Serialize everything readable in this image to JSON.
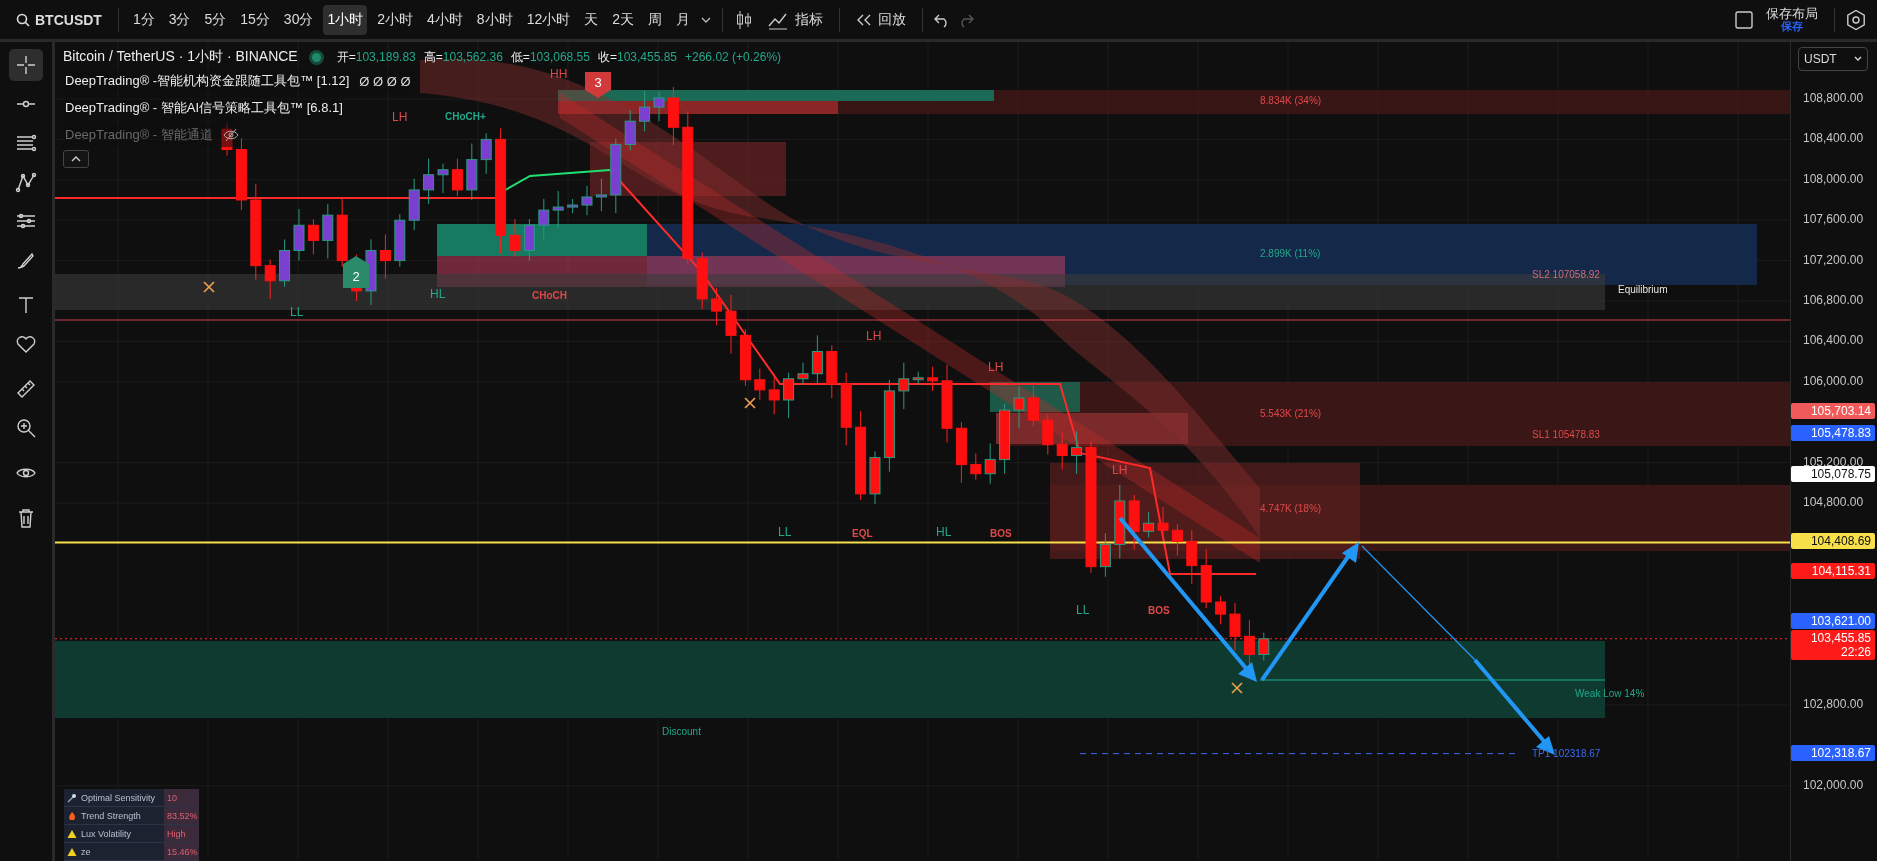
{
  "toolbar": {
    "symbol": "BTCUSDT",
    "intervals": [
      {
        "label": "1分",
        "selected": false
      },
      {
        "label": "3分",
        "selected": false
      },
      {
        "label": "5分",
        "selected": false
      },
      {
        "label": "15分",
        "selected": false
      },
      {
        "label": "30分",
        "selected": false
      },
      {
        "label": "1小时",
        "selected": true
      },
      {
        "label": "2小时",
        "selected": false
      },
      {
        "label": "4小时",
        "selected": false
      },
      {
        "label": "8小时",
        "selected": false
      },
      {
        "label": "12小时",
        "selected": false
      },
      {
        "label": "天",
        "selected": false
      },
      {
        "label": "2天",
        "selected": false
      },
      {
        "label": "周",
        "selected": false
      },
      {
        "label": "月",
        "selected": false
      }
    ],
    "indicators_button": "指标",
    "replay_button": "回放",
    "save_layout": {
      "title": "保存布局",
      "subtitle": "保存"
    }
  },
  "tools": [
    {
      "selected": true
    },
    {
      "selected": false
    },
    {
      "selected": false
    },
    {
      "selected": false
    },
    {
      "selected": false
    },
    {
      "selected": false
    },
    {
      "selected": false
    },
    {
      "selected": false
    },
    {
      "selected": false
    },
    {
      "selected": false
    },
    {
      "selected": false
    },
    {
      "selected": false
    }
  ],
  "legend": {
    "title": "Bitcoin / TetherUS · 1小时 · BINANCE",
    "ohlc": [
      {
        "label": "开=",
        "value": "103,189.83"
      },
      {
        "label": "高=",
        "value": "103,562.36"
      },
      {
        "label": "低=",
        "value": "103,068.55"
      },
      {
        "label": "收=",
        "value": "103,455.85"
      }
    ],
    "change": "+266.02 (+0.26%)",
    "indicators": [
      {
        "name": "DeepTrading® -智能机构资金跟随工具包™ [1.12]",
        "values": "Ø Ø Ø Ø",
        "visible": true
      },
      {
        "name": "DeepTrading® - 智能AI信号策略工具包™ [6.8.1]",
        "visible": true
      },
      {
        "name": "DeepTrading® - 智能通道",
        "visible": false
      }
    ]
  },
  "currency": "USDT",
  "price_axis": {
    "ticks": [
      "108,800.00",
      "108,400.00",
      "108,000.00",
      "107,600.00",
      "107,200.00",
      "106,800.00",
      "106,400.00",
      "106,000.00",
      "105,200.00",
      "104,800.00",
      "102,800.00",
      "102,000.00"
    ],
    "tags": [
      {
        "value": "105,703.14",
        "color": "#f05a5a"
      },
      {
        "value": "105,478.83",
        "color": "#2962ff"
      },
      {
        "value": "105,078.75",
        "color": "#ffffff"
      },
      {
        "value": "104,408.69",
        "color": "#f7e049"
      },
      {
        "value": "104,115.31",
        "color": "#ff1a1a"
      },
      {
        "value": "103,621.00",
        "color": "#2962ff"
      },
      {
        "value": "103,455.85",
        "color": "#ff1a1a",
        "countdown": "22:26"
      },
      {
        "value": "102,318.67",
        "color": "#2962ff"
      }
    ]
  },
  "chart_labels": [
    {
      "text": "HH",
      "kind": "structure",
      "color": "#e04848"
    },
    {
      "text": "LH",
      "kind": "structure",
      "color": "#e04848"
    },
    {
      "text": "CHoCH+",
      "kind": "tag",
      "color": "#22a88a"
    },
    {
      "text": "HL",
      "kind": "structure",
      "color": "#22a88a"
    },
    {
      "text": "LL",
      "kind": "structure",
      "color": "#22a88a"
    },
    {
      "text": "CHoCH",
      "kind": "tag",
      "color": "#e04848"
    },
    {
      "text": "LH",
      "kind": "structure",
      "color": "#e04848"
    },
    {
      "text": "LH",
      "kind": "structure",
      "color": "#e04848"
    },
    {
      "text": "LH",
      "kind": "structure",
      "color": "#e04848"
    },
    {
      "text": "LL",
      "kind": "structure",
      "color": "#22a88a"
    },
    {
      "text": "EQL",
      "kind": "tag",
      "color": "#e04848"
    },
    {
      "text": "HL",
      "kind": "structure",
      "color": "#22a88a"
    },
    {
      "text": "BOS",
      "kind": "tag",
      "color": "#e04848"
    },
    {
      "text": "LL",
      "kind": "structure",
      "color": "#22a88a"
    },
    {
      "text": "BOS",
      "kind": "tag",
      "color": "#e04848"
    },
    {
      "text": "8.834K (34%)",
      "kind": "level",
      "color": "#e04848"
    },
    {
      "text": "2.899K (11%)",
      "kind": "level",
      "color": "#22a88a"
    },
    {
      "text": "SL2 107058.92",
      "kind": "level",
      "color": "#d06a7a"
    },
    {
      "text": "Equilibrium",
      "kind": "level",
      "color": "#e8e8e8"
    },
    {
      "text": "5.543K (21%)",
      "kind": "level",
      "color": "#e04848"
    },
    {
      "text": "SL1 105478.83",
      "kind": "level",
      "color": "#e04848"
    },
    {
      "text": "4.747K (18%)",
      "kind": "level",
      "color": "#e04848"
    },
    {
      "text": "Weak Low 14%",
      "kind": "level",
      "color": "#22a88a"
    },
    {
      "text": "Discount",
      "kind": "level",
      "color": "#22a88a"
    },
    {
      "text": "TP1 102318.67",
      "kind": "level",
      "color": "#3a6af0"
    }
  ],
  "signal_badges": [
    {
      "text": "3",
      "color": "#d03a3a"
    },
    {
      "text": "2",
      "color": "#2a8a6a"
    }
  ],
  "stats": [
    {
      "label": "Optimal Sensitivity",
      "value": "10"
    },
    {
      "label": "Trend Strength",
      "value": "83.52%"
    },
    {
      "label": "Lux Volatility",
      "value": "High"
    },
    {
      "label": "ze",
      "value": "15.46%"
    }
  ]
}
